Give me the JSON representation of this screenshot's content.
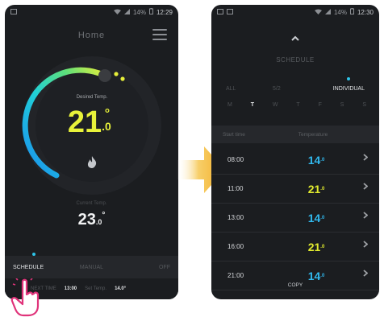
{
  "left_phone": {
    "status": {
      "icons_left": "notification-icon",
      "signal": "wifi-signal-battery",
      "time": "12:29",
      "network": "14%"
    },
    "title": "Home",
    "dial": {
      "label": "Desired Temp.",
      "value_int": "21",
      "value_dec": ".0",
      "degree": "°"
    },
    "current": {
      "label": "Current Temp.",
      "value_int": "23",
      "value_dec": ".0",
      "degree": "°"
    },
    "tabs": [
      {
        "label": "SCHEDULE"
      },
      {
        "label": "MANUAL"
      },
      {
        "label": "OFF"
      }
    ],
    "bottom": {
      "next_label": "NEXT TIME",
      "next_time": "13:00",
      "next_temp_label": "Set Temp.",
      "next_temp": "14.0°"
    }
  },
  "right_phone": {
    "status": {
      "time": "12:30",
      "network": "14%"
    },
    "title": "SCHEDULE",
    "modes": [
      {
        "label": "ALL"
      },
      {
        "label": "5/2"
      },
      {
        "label": "INDIVIDUAL"
      }
    ],
    "days": [
      "M",
      "T",
      "W",
      "T",
      "F",
      "S",
      "S"
    ],
    "selected_day_index": 1,
    "table": {
      "col_start": "Start time",
      "col_temp": "Temperature",
      "rows": [
        {
          "time": "08:00",
          "temp": "14",
          "dec": ".0",
          "color": "#31b9ee"
        },
        {
          "time": "11:00",
          "temp": "21",
          "dec": ".0",
          "color": "#e2ec2e"
        },
        {
          "time": "13:00",
          "temp": "14",
          "dec": ".0",
          "color": "#31b9ee"
        },
        {
          "time": "16:00",
          "temp": "21",
          "dec": ".0",
          "color": "#e2ec2e"
        },
        {
          "time": "21:00",
          "temp": "14",
          "dec": ".0",
          "color": "#31b9ee"
        }
      ]
    },
    "copy_label": "COPY"
  },
  "colors": {
    "accent_blue": "#2ec4e8",
    "accent_yellow": "#e8f23a",
    "hand_pink": "#e0337a",
    "arrow_yellow": "#f5b830"
  }
}
